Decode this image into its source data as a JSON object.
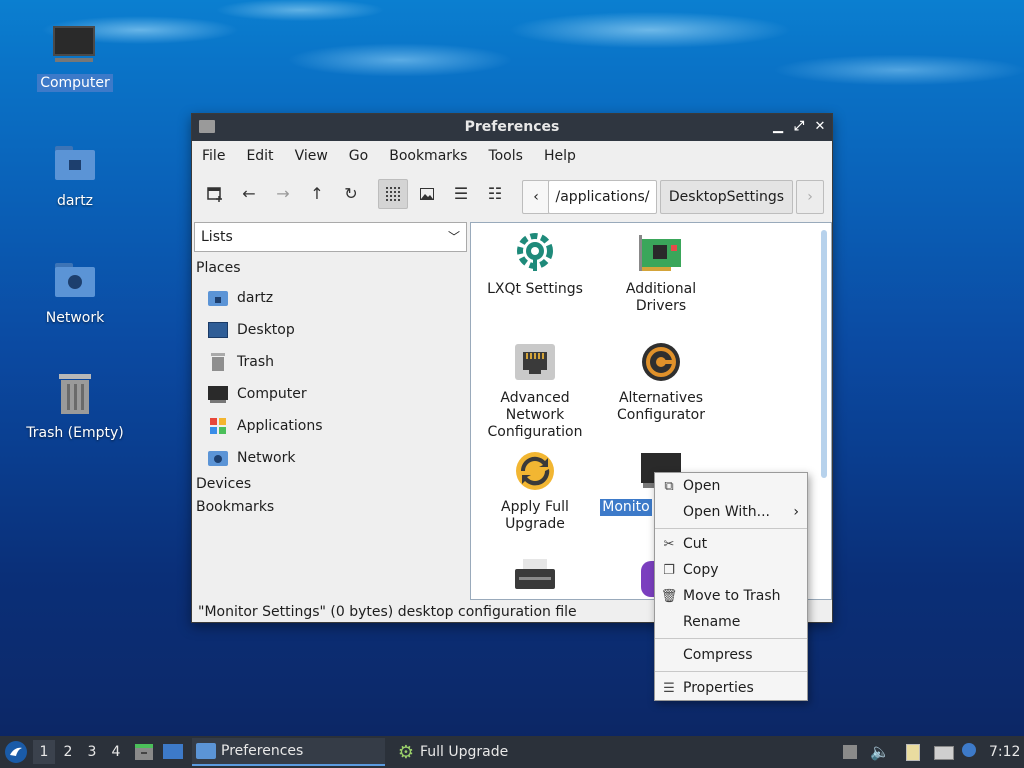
{
  "desktop": {
    "icons": [
      {
        "label": "Computer"
      },
      {
        "label": "dartz"
      },
      {
        "label": "Network"
      },
      {
        "label": "Trash (Empty)"
      }
    ]
  },
  "window": {
    "title": "Preferences",
    "controls": {
      "minimize": "▁",
      "maximize": "⤢",
      "close": "✕"
    },
    "menu": [
      "File",
      "Edit",
      "View",
      "Go",
      "Bookmarks",
      "Tools",
      "Help"
    ],
    "path": {
      "back": "‹",
      "segment1": "/applications/",
      "segment2": "DesktopSettings",
      "forward": "›"
    },
    "sidebar": {
      "mode": "Lists",
      "sections": {
        "places": "Places",
        "devices": "Devices",
        "bookmarks": "Bookmarks"
      },
      "places": [
        {
          "label": "dartz",
          "icon": "home-folder-icon"
        },
        {
          "label": "Desktop",
          "icon": "desktop-icon"
        },
        {
          "label": "Trash",
          "icon": "trash-icon"
        },
        {
          "label": "Computer",
          "icon": "computer-icon"
        },
        {
          "label": "Applications",
          "icon": "applications-icon"
        },
        {
          "label": "Network",
          "icon": "network-icon"
        }
      ]
    },
    "files": [
      {
        "label": "LXQt Settings",
        "icon": "gear-icon"
      },
      {
        "label": "Additional Drivers",
        "icon": "pci-card-icon"
      },
      {
        "label": "Advanced Network Configuration",
        "icon": "ethernet-icon"
      },
      {
        "label": "Alternatives Configurator",
        "icon": "alternatives-icon"
      },
      {
        "label": "Apply Full Upgrade",
        "icon": "upgrade-icon"
      },
      {
        "label": "Monito",
        "icon": "monitor-icon"
      }
    ],
    "status": "\"Monitor Settings\" (0 bytes) desktop configuration file"
  },
  "context_menu": {
    "items": [
      {
        "label": "Open",
        "icon": "open-icon"
      },
      {
        "label": "Open With...",
        "icon": ""
      },
      {
        "label": "Cut",
        "icon": "scissors-icon"
      },
      {
        "label": "Copy",
        "icon": "copy-icon"
      },
      {
        "label": "Move to Trash",
        "icon": "trash-icon"
      },
      {
        "label": "Rename",
        "icon": ""
      },
      {
        "label": "Compress",
        "icon": ""
      },
      {
        "label": "Properties",
        "icon": "properties-icon"
      }
    ],
    "submenu_arrow": "›"
  },
  "taskbar": {
    "workspaces": [
      "1",
      "2",
      "3",
      "4"
    ],
    "tasks": [
      {
        "label": "Preferences"
      },
      {
        "label": "Full Upgrade"
      }
    ],
    "clock": "7:12"
  },
  "colors": {
    "selection": "#3d7ac9",
    "titlebar": "#2f3640",
    "taskbar": "#2b313a"
  }
}
